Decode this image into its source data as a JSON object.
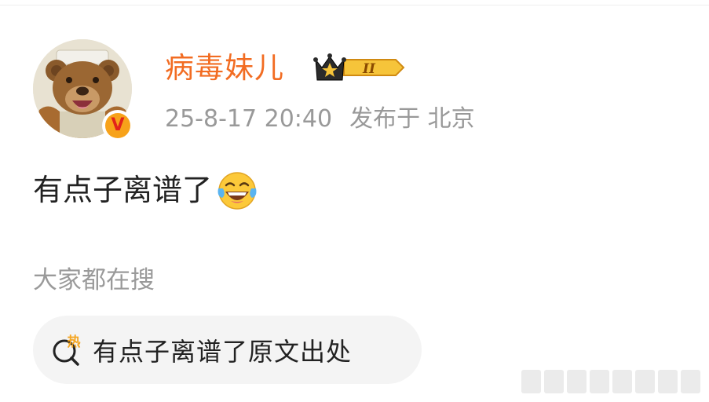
{
  "post": {
    "author": {
      "name": "病毒妹儿",
      "vip_level": "II",
      "verified_mark": "V"
    },
    "timestamp": "25-8-17 20:40",
    "location": "发布于 北京",
    "content_text": "有点子离谱了",
    "content_emoji": "laugh-tears-emoji"
  },
  "trending": {
    "heading": "大家都在搜",
    "hot_tag": "热",
    "query": "有点子离谱了原文出处"
  },
  "colors": {
    "username": "#f26c22",
    "meta_text": "#999999",
    "body_text": "#222222",
    "pill_bg": "#f4f4f4",
    "verified_orange": "#f7a21a",
    "verified_red": "#e2231a",
    "vip_gold": "#f6c43a",
    "hot_icon": "#f5a623"
  }
}
